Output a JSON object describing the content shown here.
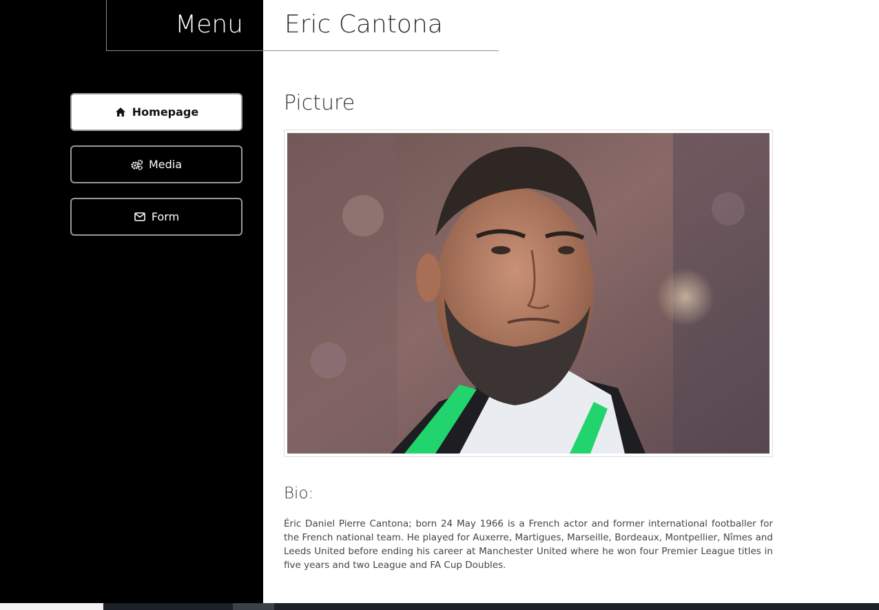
{
  "header": {
    "menu_title": "Menu",
    "page_title": "Eric Cantona"
  },
  "nav": {
    "items": [
      {
        "label": "Homepage",
        "icon": "home-icon",
        "active": true
      },
      {
        "label": "Media",
        "icon": "gears-icon",
        "active": false
      },
      {
        "label": "Form",
        "icon": "envelope-icon",
        "active": false
      }
    ]
  },
  "main": {
    "picture_heading": "Picture",
    "bio_heading": "Bio:",
    "bio_text": "Éric Daniel Pierre Cantona; born 24 May 1966 is a French actor and former international footballer for the French national team. He played for Auxerre, Martigues, Marseille, Bordeaux, Montpellier, Nîmes and Leeds United before ending his career at Manchester United where he won four Premier League titles in five years and two League and FA Cup Doubles."
  },
  "colors": {
    "sidebar_bg": "#000000",
    "accent_green": "#2ecc71",
    "text": "#333333"
  }
}
